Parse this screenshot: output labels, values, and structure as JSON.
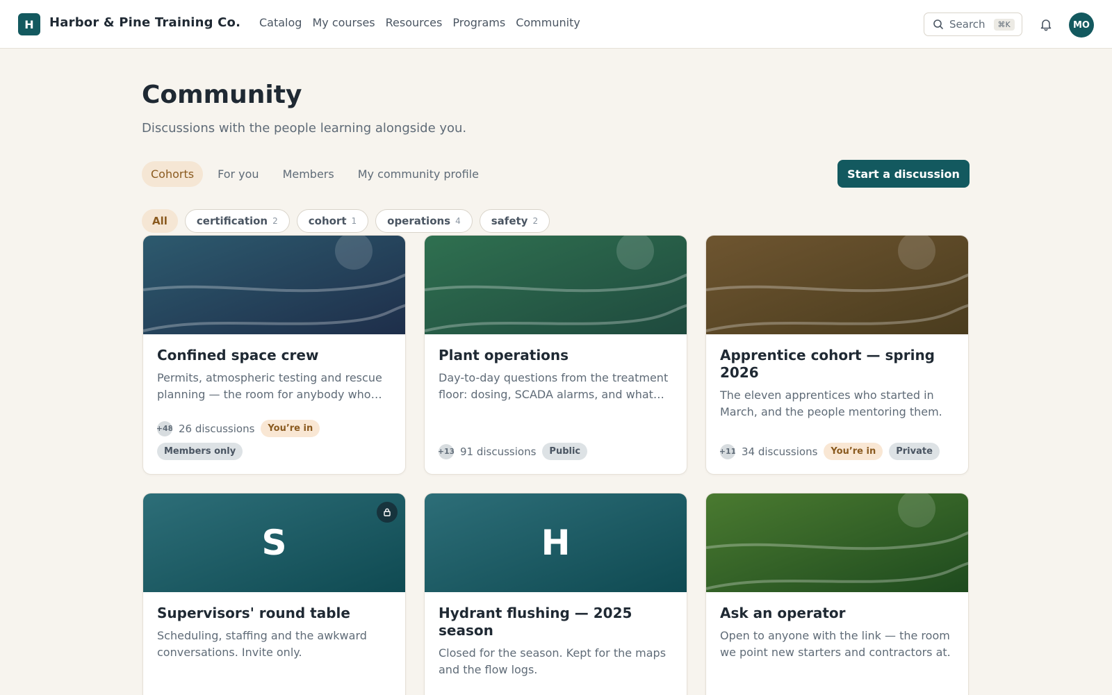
{
  "app": {
    "logo_letter": "H",
    "brand": "Harbor & Pine Training Co.",
    "nav": [
      "Catalog",
      "My courses",
      "Resources",
      "Programs",
      "Community"
    ],
    "search": {
      "label": "Search",
      "shortcut": "⌘K"
    },
    "user_initials": "MO"
  },
  "header": {
    "title": "Community",
    "subtitle": "Discussions with the people learning alongside you."
  },
  "tabs": [
    {
      "label": "Cohorts",
      "active": true
    },
    {
      "label": "For you",
      "active": false
    },
    {
      "label": "Members",
      "active": false
    },
    {
      "label": "My community profile",
      "active": false
    }
  ],
  "cta": "Start a discussion",
  "filters": [
    {
      "label": "All",
      "count": "",
      "active": true
    },
    {
      "label": "certification",
      "count": "2",
      "active": false
    },
    {
      "label": "cohort",
      "count": "1",
      "active": false
    },
    {
      "label": "operations",
      "count": "4",
      "active": false
    },
    {
      "label": "safety",
      "count": "2",
      "active": false
    }
  ],
  "cards": [
    {
      "title": "Confined space crew",
      "description": "Permits, atmospheric testing and rescue planning — the room for anybody who…",
      "member_badge": "+48",
      "discussions": "26 discussions",
      "badges": [
        {
          "label": "You’re in",
          "kind": "in"
        },
        {
          "label": "Members only",
          "kind": "gray"
        }
      ],
      "cover": {
        "style": "waves",
        "color_top": "#2d5a6e",
        "color_bottom": "#1e2e4a"
      }
    },
    {
      "title": "Plant operations",
      "description": "Day-to-day questions from the treatment floor: dosing, SCADA alarms, and what to…",
      "member_badge": "+13",
      "discussions": "91 discussions",
      "badges": [
        {
          "label": "Public",
          "kind": "gray"
        }
      ],
      "cover": {
        "style": "waves",
        "color_top": "#2f7050",
        "color_bottom": "#1f4a3e"
      }
    },
    {
      "title": "Apprentice cohort — spring 2026",
      "description": "The eleven apprentices who started in March, and the people mentoring them.",
      "member_badge": "+11",
      "discussions": "34 discussions",
      "badges": [
        {
          "label": "You’re in",
          "kind": "in"
        },
        {
          "label": "Private",
          "kind": "gray"
        }
      ],
      "cover": {
        "style": "waves",
        "color_top": "#6e5530",
        "color_bottom": "#4a3c1e"
      }
    },
    {
      "title": "Supervisors' round table",
      "description": "Scheduling, staffing and the awkward conversations. Invite only.",
      "initial": "S",
      "locked": true,
      "cover": {
        "style": "initial",
        "color_top": "#2d6e78",
        "color_bottom": "#0f4a52"
      }
    },
    {
      "title": "Hydrant flushing — 2025 season",
      "description": "Closed for the season. Kept for the maps and the flow logs.",
      "initial": "H",
      "locked": false,
      "cover": {
        "style": "initial",
        "color_top": "#2d6e78",
        "color_bottom": "#0f4a52"
      }
    },
    {
      "title": "Ask an operator",
      "description": "Open to anyone with the link — the room we point new starters and contractors at.",
      "cover": {
        "style": "waves",
        "color_top": "#4a7a30",
        "color_bottom": "#1e4a1e"
      }
    }
  ]
}
